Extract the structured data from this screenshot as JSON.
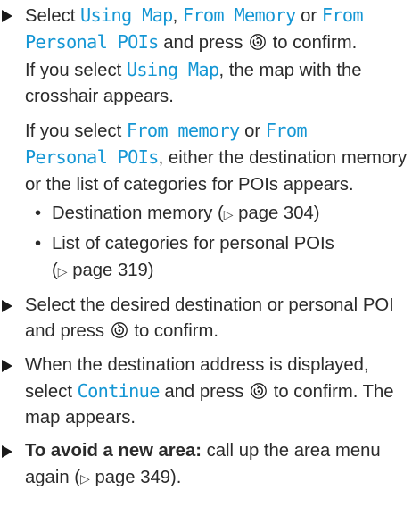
{
  "steps": [
    {
      "lines": {
        "l1_pre": "Select ",
        "opt1": "Using Map",
        "sep1": ", ",
        "opt2": "From Memory",
        "sep2": " or ",
        "opt3a": "From",
        "opt3b": "Personal POIs",
        "l2_post": " and press ",
        "l2_end": " to confirm.",
        "l3": "If you select ",
        "l3_opt": "Using Map",
        "l3_post": ", the map with the",
        "l4": "crosshair appears."
      },
      "para2": {
        "pre": "If you select ",
        "opt1": "From memory",
        "mid": " or ",
        "opt2a": "From",
        "opt2b": "Personal POIs",
        "post": ", either the destination memory or the list of categories for POIs appears."
      },
      "bullets": [
        {
          "text": "Destination memory (",
          "page": "page 304",
          "close": ")"
        },
        {
          "text": "List of categories for personal POIs",
          "page": "page 319",
          "close": ")"
        }
      ]
    },
    {
      "pre": "Select the desired destination or personal POI and press ",
      "post": " to confirm."
    },
    {
      "pre": "When the destination address is displayed, select ",
      "opt": "Continue",
      "mid": " and press ",
      "post": " to confirm. The map appears."
    },
    {
      "bold": "To avoid a new area:",
      "pre": " call up the area menu again (",
      "page": "page 349",
      "post": ")."
    }
  ],
  "icons": {
    "step_marker": "right-triangle-arrow-icon",
    "controller": "controller-knob-icon",
    "page_ref": "page-reference-triangle-icon"
  },
  "colors": {
    "option_text": "#1496d4",
    "body_text": "#2b2b2b"
  }
}
